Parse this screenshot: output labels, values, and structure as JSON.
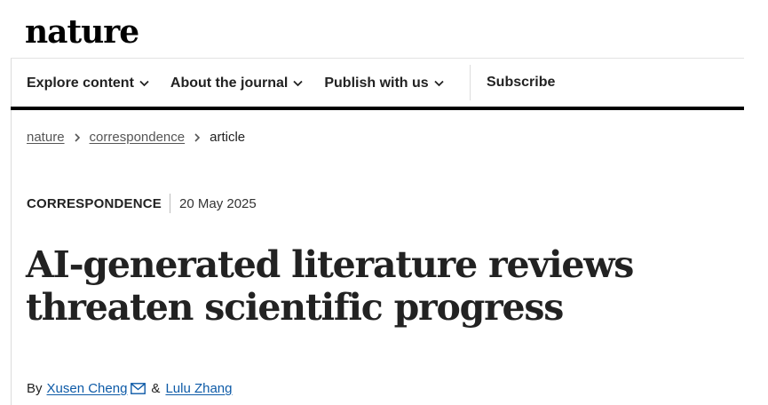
{
  "site": {
    "logo_text": "nature"
  },
  "nav": {
    "items": [
      {
        "label": "Explore content",
        "icon": "chevron-down-icon"
      },
      {
        "label": "About the journal",
        "icon": "chevron-down-icon"
      },
      {
        "label": "Publish with us",
        "icon": "chevron-down-icon"
      }
    ],
    "subscribe_label": "Subscribe"
  },
  "breadcrumb": {
    "items": [
      "nature",
      "correspondence"
    ],
    "current": "article",
    "separator_icon": "chevron-right-icon"
  },
  "article": {
    "type": "CORRESPONDENCE",
    "date": "20 May 2025",
    "title_line1": "AI-generated literature reviews",
    "title_line2": "threaten scientific progress",
    "by_label": "By",
    "authors": [
      {
        "name": "Xusen Cheng",
        "icon": "mail-icon"
      },
      {
        "name": "Lulu Zhang"
      }
    ],
    "author_separator": "&"
  },
  "colors": {
    "text": "#222222",
    "link": "#0d5aa7",
    "rule": "#000000"
  }
}
